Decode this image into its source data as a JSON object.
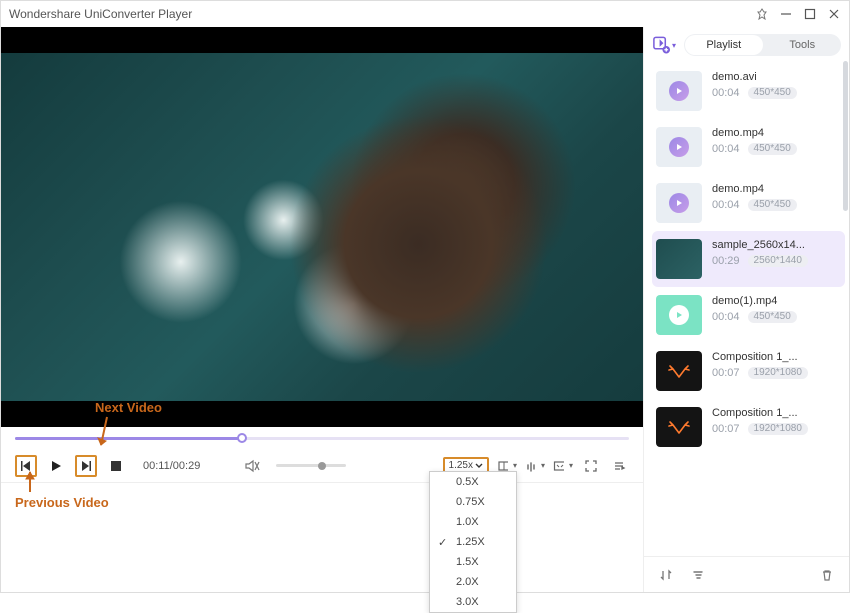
{
  "window": {
    "title": "Wondershare UniConverter Player"
  },
  "annotations": {
    "next": "Next Video",
    "prev": "Previous Video"
  },
  "player": {
    "time_current": "00:11",
    "time_total": "00:29",
    "progress_pct": 37,
    "speed_label": "1.25x"
  },
  "speed_menu": {
    "items": [
      "0.5X",
      "0.75X",
      "1.0X",
      "1.25X",
      "1.5X",
      "2.0X",
      "3.0X"
    ],
    "selected": "1.25X"
  },
  "panel": {
    "tabs": {
      "playlist": "Playlist",
      "tools": "Tools"
    },
    "items": [
      {
        "name": "demo.avi",
        "duration": "00:04",
        "resolution": "450*450",
        "thumb": "light"
      },
      {
        "name": "demo.mp4",
        "duration": "00:04",
        "resolution": "450*450",
        "thumb": "light"
      },
      {
        "name": "demo.mp4",
        "duration": "00:04",
        "resolution": "450*450",
        "thumb": "light"
      },
      {
        "name": "sample_2560x14...",
        "duration": "00:29",
        "resolution": "2560*1440",
        "thumb": "scene",
        "selected": true
      },
      {
        "name": "demo(1).mp4",
        "duration": "00:04",
        "resolution": "450*450",
        "thumb": "teal"
      },
      {
        "name": "Composition 1_...",
        "duration": "00:07",
        "resolution": "1920*1080",
        "thumb": "dark"
      },
      {
        "name": "Composition 1_...",
        "duration": "00:07",
        "resolution": "1920*1080",
        "thumb": "dark"
      }
    ]
  }
}
